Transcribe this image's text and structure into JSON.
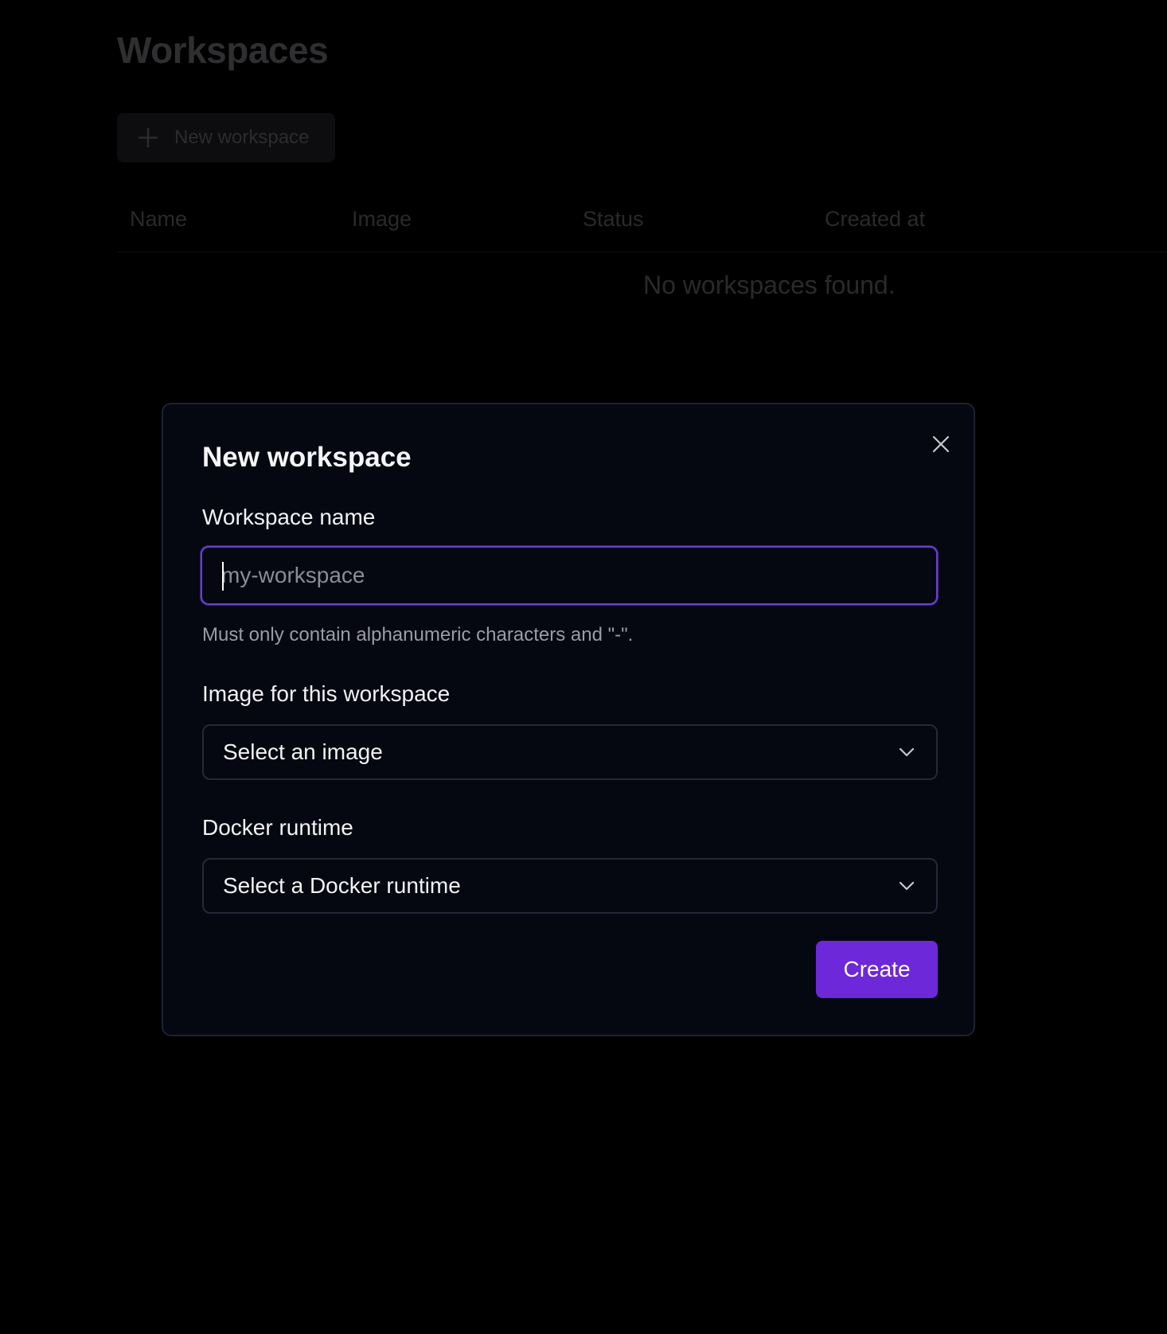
{
  "page": {
    "title": "Workspaces",
    "new_button_label": "New workspace",
    "table": {
      "columns": [
        "Name",
        "Image",
        "Status",
        "Created at"
      ],
      "empty_message": "No workspaces found."
    }
  },
  "modal": {
    "title": "New workspace",
    "close_icon": "close-icon",
    "name_field": {
      "label": "Workspace name",
      "placeholder": "my-workspace",
      "value": "",
      "hint": "Must only contain alphanumeric characters and \"-\"."
    },
    "image_field": {
      "label": "Image for this workspace",
      "selected": "Select an image",
      "icon": "chevron-down-icon"
    },
    "runtime_field": {
      "label": "Docker runtime",
      "selected": "Select a Docker runtime",
      "icon": "chevron-down-icon"
    },
    "create_label": "Create"
  },
  "colors": {
    "accent": "#6d28d9",
    "focus_border": "#6b3fd4",
    "modal_bg": "#050810",
    "page_bg": "#000000"
  }
}
